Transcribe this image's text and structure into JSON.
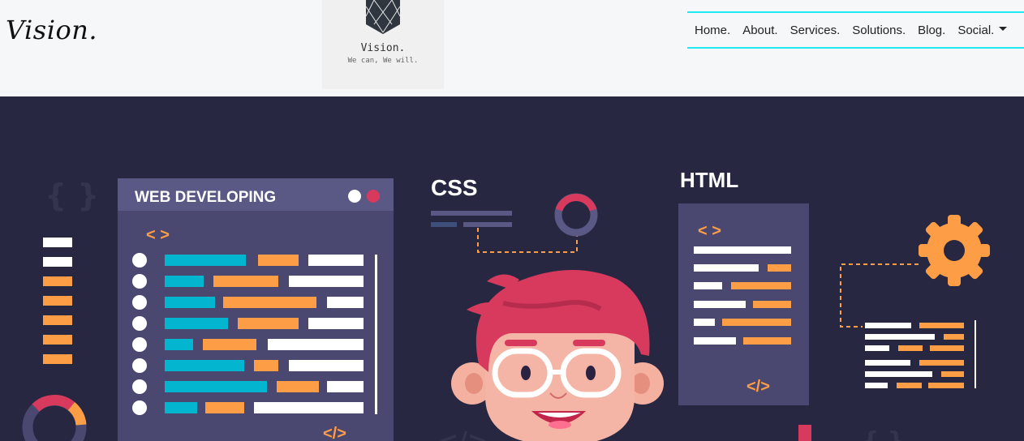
{
  "brand": {
    "title": "Vision."
  },
  "logo": {
    "name": "Vision.",
    "tagline": "We can, We will."
  },
  "nav": {
    "items": [
      {
        "label": "Home."
      },
      {
        "label": "About."
      },
      {
        "label": "Services."
      },
      {
        "label": "Solutions."
      },
      {
        "label": "Blog."
      },
      {
        "label": "Social."
      }
    ]
  },
  "hero": {
    "panel_title": "WEB DEVELOPING",
    "css_label": "CSS",
    "html_label": "HTML",
    "code_open": "< >",
    "code_close": "</>"
  },
  "colors": {
    "accent": "#1de9f0",
    "hero_bg": "#272741",
    "panel": "#4a4870",
    "orange": "#fd9d46",
    "cyan": "#04b5d0",
    "pink": "#d83a5e"
  }
}
